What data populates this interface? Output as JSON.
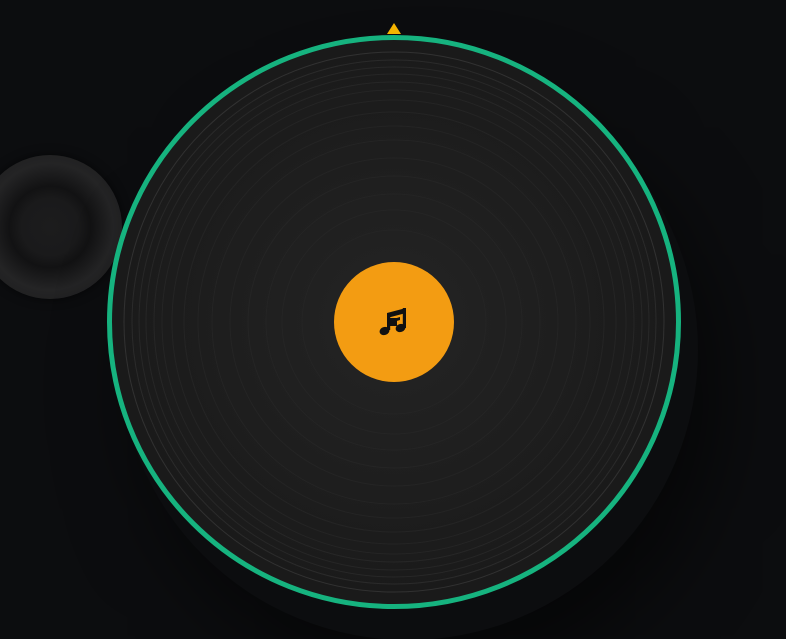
{
  "app": {
    "title": ""
  },
  "turntable": {
    "record_icon": "music-note-icon",
    "pointer_icon": "triangle-pointer-icon",
    "knob_icon": "knob-icon"
  },
  "colors": {
    "background": "#0c0d0f",
    "record_ring": "#16b37f",
    "record_label": "#f39c12",
    "pointer": "#f5b400",
    "vinyl": "#1d1d1d"
  }
}
